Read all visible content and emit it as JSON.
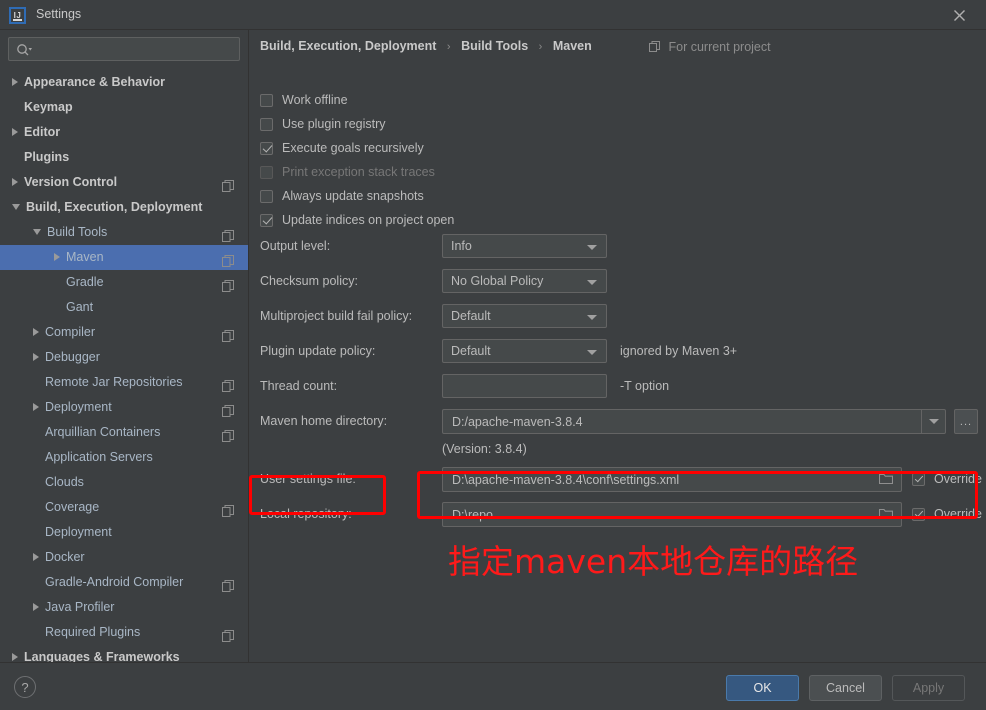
{
  "window": {
    "title": "Settings",
    "logo_text": "IJ",
    "close_icon": "close-icon"
  },
  "sidebar": {
    "search": {
      "value": "",
      "placeholder": "",
      "icon": "search-icon"
    },
    "tree": [
      {
        "label": "Appearance & Behavior",
        "indent": 0,
        "arrow": "closed",
        "bold": true,
        "badge": false,
        "selected": false
      },
      {
        "label": "Keymap",
        "indent": 0,
        "arrow": "none",
        "bold": true,
        "badge": false,
        "selected": false
      },
      {
        "label": "Editor",
        "indent": 0,
        "arrow": "closed",
        "bold": true,
        "badge": false,
        "selected": false
      },
      {
        "label": "Plugins",
        "indent": 0,
        "arrow": "none",
        "bold": true,
        "badge": false,
        "selected": false
      },
      {
        "label": "Version Control",
        "indent": 0,
        "arrow": "closed",
        "bold": true,
        "badge": true,
        "selected": false
      },
      {
        "label": "Build, Execution, Deployment",
        "indent": 0,
        "arrow": "open",
        "bold": true,
        "badge": false,
        "selected": false
      },
      {
        "label": "Build Tools",
        "indent": 1,
        "arrow": "open",
        "bold": false,
        "badge": true,
        "selected": false
      },
      {
        "label": "Maven",
        "indent": 2,
        "arrow": "closed",
        "bold": false,
        "badge": true,
        "selected": true
      },
      {
        "label": "Gradle",
        "indent": 2,
        "arrow": "none",
        "bold": false,
        "badge": true,
        "selected": false
      },
      {
        "label": "Gant",
        "indent": 2,
        "arrow": "none",
        "bold": false,
        "badge": false,
        "selected": false
      },
      {
        "label": "Compiler",
        "indent": 1,
        "arrow": "closed",
        "bold": false,
        "badge": true,
        "selected": false
      },
      {
        "label": "Debugger",
        "indent": 1,
        "arrow": "closed",
        "bold": false,
        "badge": false,
        "selected": false
      },
      {
        "label": "Remote Jar Repositories",
        "indent": 1,
        "arrow": "none",
        "bold": false,
        "badge": true,
        "selected": false
      },
      {
        "label": "Deployment",
        "indent": 1,
        "arrow": "closed",
        "bold": false,
        "badge": true,
        "selected": false
      },
      {
        "label": "Arquillian Containers",
        "indent": 1,
        "arrow": "none",
        "bold": false,
        "badge": true,
        "selected": false
      },
      {
        "label": "Application Servers",
        "indent": 1,
        "arrow": "none",
        "bold": false,
        "badge": false,
        "selected": false
      },
      {
        "label": "Clouds",
        "indent": 1,
        "arrow": "none",
        "bold": false,
        "badge": false,
        "selected": false
      },
      {
        "label": "Coverage",
        "indent": 1,
        "arrow": "none",
        "bold": false,
        "badge": true,
        "selected": false
      },
      {
        "label": "Deployment",
        "indent": 1,
        "arrow": "none",
        "bold": false,
        "badge": false,
        "selected": false
      },
      {
        "label": "Docker",
        "indent": 1,
        "arrow": "closed",
        "bold": false,
        "badge": false,
        "selected": false
      },
      {
        "label": "Gradle-Android Compiler",
        "indent": 1,
        "arrow": "none",
        "bold": false,
        "badge": true,
        "selected": false
      },
      {
        "label": "Java Profiler",
        "indent": 1,
        "arrow": "closed",
        "bold": false,
        "badge": false,
        "selected": false
      },
      {
        "label": "Required Plugins",
        "indent": 1,
        "arrow": "none",
        "bold": false,
        "badge": true,
        "selected": false
      },
      {
        "label": "Languages & Frameworks",
        "indent": 0,
        "arrow": "closed",
        "bold": true,
        "badge": false,
        "selected": false
      }
    ]
  },
  "main": {
    "breadcrumb": {
      "crumb1": "Build, Execution, Deployment",
      "crumb2": "Build Tools",
      "crumb3": "Maven",
      "separator": "›"
    },
    "for_current_project": "For current project",
    "checkboxes": [
      {
        "label": "Work offline",
        "checked": false,
        "disabled": false
      },
      {
        "label": "Use plugin registry",
        "checked": false,
        "disabled": false
      },
      {
        "label": "Execute goals recursively",
        "checked": true,
        "disabled": false
      },
      {
        "label": "Print exception stack traces",
        "checked": false,
        "disabled": true
      },
      {
        "label": "Always update snapshots",
        "checked": false,
        "disabled": false
      },
      {
        "label": "Update indices on project open",
        "checked": true,
        "disabled": false
      }
    ],
    "fields": {
      "output_level": {
        "label": "Output level:",
        "value": "Info"
      },
      "checksum_policy": {
        "label": "Checksum policy:",
        "value": "No Global Policy"
      },
      "multiproject_policy": {
        "label": "Multiproject build fail policy:",
        "value": "Default"
      },
      "plugin_update": {
        "label": "Plugin update policy:",
        "value": "Default",
        "hint": "ignored by Maven 3+"
      },
      "thread_count": {
        "label": "Thread count:",
        "value": "",
        "hint": "-T option"
      },
      "maven_home": {
        "label": "Maven home directory:",
        "value": "D:/apache-maven-3.8.4",
        "browse": "..."
      },
      "version_note": "(Version: 3.8.4)",
      "user_settings": {
        "label": "User settings file:",
        "value": "D:\\apache-maven-3.8.4\\conf\\settings.xml",
        "override": "Override",
        "override_checked": true
      },
      "local_repository": {
        "label": "Local repository:",
        "value": "D:\\repo",
        "override": "Override",
        "override_checked": true
      }
    },
    "annotation_text": "指定maven本地仓库的路径"
  },
  "footer": {
    "help": "?",
    "ok": "OK",
    "cancel": "Cancel",
    "apply": "Apply"
  },
  "colors": {
    "background": "#3c3f41",
    "selection": "#4b6eaf",
    "primary_button": "#365880",
    "annotation": "#fe0000"
  }
}
